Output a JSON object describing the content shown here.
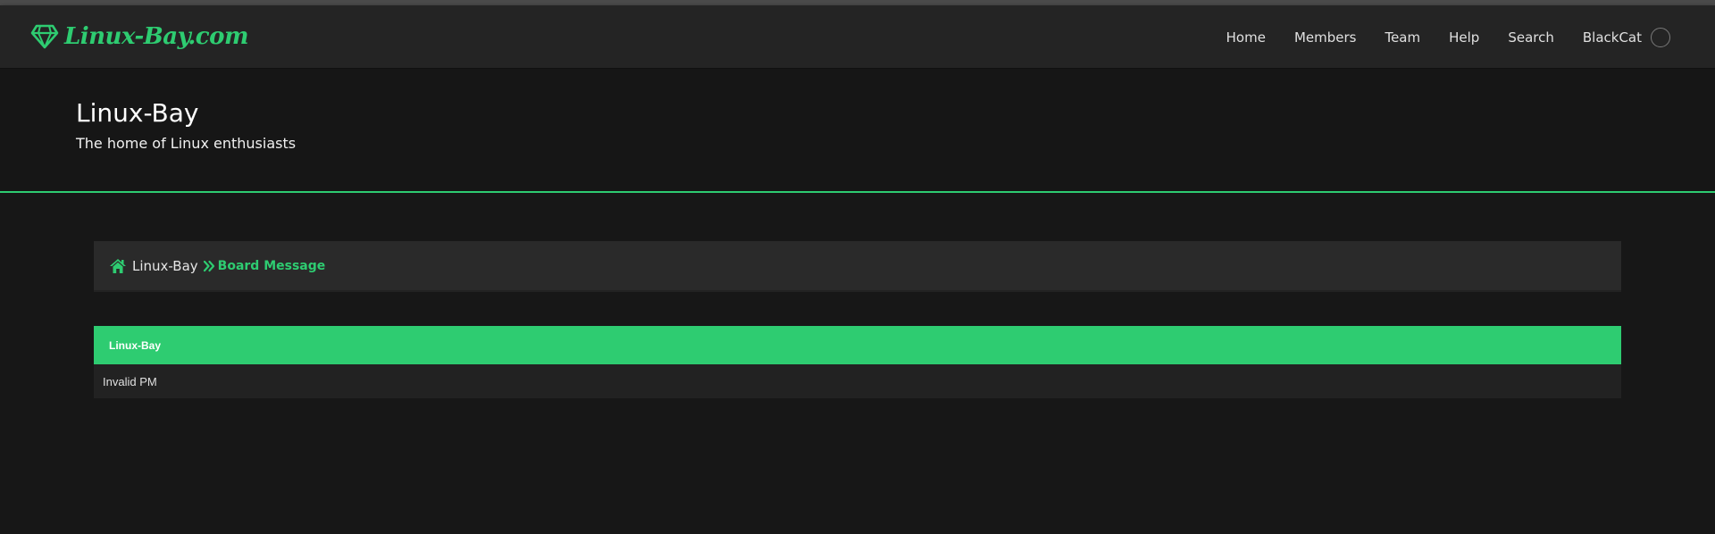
{
  "site": {
    "logo_text": "Linux-Bay.com",
    "title": "Linux-Bay",
    "tagline": "The home of Linux enthusiasts"
  },
  "nav": {
    "items": [
      "Home",
      "Members",
      "Team",
      "Help",
      "Search"
    ],
    "user": "BlackCat"
  },
  "breadcrumb": {
    "home": "Linux-Bay",
    "current": "Board Message"
  },
  "message": {
    "header": "Linux-Bay",
    "body": "Invalid PM"
  },
  "colors": {
    "accent": "#2ecc71",
    "background": "#171717",
    "navbar": "#242424",
    "panel": "#2a2a2a"
  },
  "icons": [
    "diamond-icon",
    "home-icon",
    "double-chevron-right-icon",
    "avatar"
  ]
}
